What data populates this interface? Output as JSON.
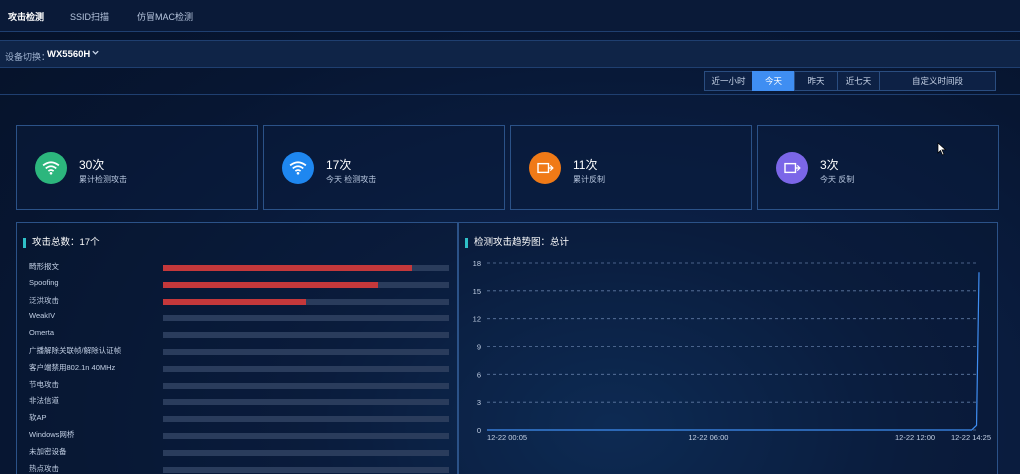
{
  "tabs": [
    {
      "label": "攻击检测",
      "active": true
    },
    {
      "label": "SSID扫描",
      "active": false
    },
    {
      "label": "仿冒MAC检测",
      "active": false
    }
  ],
  "device": {
    "label": "设备切换：",
    "value": "WX5560H"
  },
  "range_buttons": [
    {
      "label": "近一小时",
      "active": false
    },
    {
      "label": "今天",
      "active": true
    },
    {
      "label": "昨天",
      "active": false
    },
    {
      "label": "近七天",
      "active": false
    },
    {
      "label": "自定义时间段",
      "active": false
    }
  ],
  "cards": [
    {
      "num": "30次",
      "desc": "累计检测攻击",
      "icon": "wifi-icon",
      "color": "#2cb67d"
    },
    {
      "num": "17次",
      "desc": "今天 检测攻击",
      "icon": "wifi-icon",
      "color": "#1e87f0"
    },
    {
      "num": "11次",
      "desc": "累计反制",
      "icon": "counter-icon",
      "color": "#f07a17"
    },
    {
      "num": "3次",
      "desc": "今天 反制",
      "icon": "counter-icon",
      "color": "#7b66e8"
    }
  ],
  "attack_panel": {
    "title": "攻击总数：17个",
    "rows": [
      {
        "label": "畸形报文",
        "fraction": 0.87
      },
      {
        "label": "Spoofing",
        "fraction": 0.75
      },
      {
        "label": "泛洪攻击",
        "fraction": 0.5
      },
      {
        "label": "WeakIV",
        "fraction": 0
      },
      {
        "label": "Omerta",
        "fraction": 0
      },
      {
        "label": "广播解除关联帧/解除认证帧",
        "fraction": 0
      },
      {
        "label": "客户端禁用802.1n 40MHz",
        "fraction": 0
      },
      {
        "label": "节电攻击",
        "fraction": 0
      },
      {
        "label": "非法信道",
        "fraction": 0
      },
      {
        "label": "软AP",
        "fraction": 0
      },
      {
        "label": "Windows网桥",
        "fraction": 0
      },
      {
        "label": "未加密设备",
        "fraction": 0
      },
      {
        "label": "热点攻击",
        "fraction": 0
      }
    ]
  },
  "trend_panel": {
    "title": "检测攻击趋势图：总计"
  },
  "chart_data": {
    "type": "line",
    "title": "检测攻击趋势图：总计",
    "y_ticks": [
      "18",
      "15",
      "12",
      "9",
      "6",
      "3",
      "0"
    ],
    "ylim": [
      0,
      18
    ],
    "x_ticks": [
      "12-22 00:05",
      "12-22 06:00",
      "12-22 12:00",
      "12-22 14:25"
    ],
    "grid": true,
    "series": [
      {
        "color": "#3f8ef2",
        "points": [
          [
            0,
            0
          ],
          [
            0.985,
            0
          ],
          [
            0.995,
            0.5
          ],
          [
            1.0,
            17
          ]
        ]
      }
    ]
  }
}
